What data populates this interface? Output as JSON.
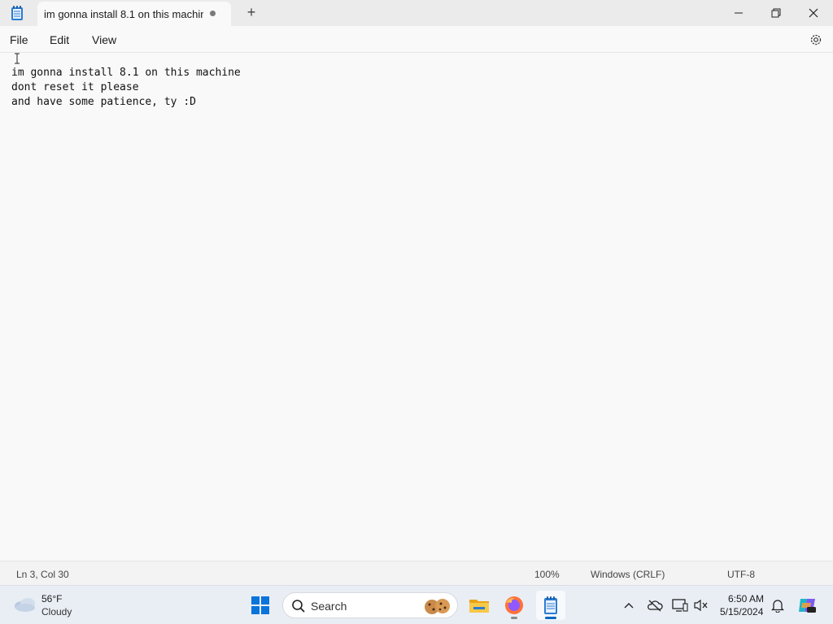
{
  "window": {
    "tab_title": "im gonna install 8.1 on this machin",
    "new_tab_symbol": "+",
    "unsaved_indicator": "modified-dot"
  },
  "menu": {
    "file": "File",
    "edit": "Edit",
    "view": "View"
  },
  "editor": {
    "text": "im gonna install 8.1 on this machine\ndont reset it please\nand have some patience, ty :D"
  },
  "statusbar": {
    "position": "Ln 3, Col 30",
    "zoom": "100%",
    "line_endings": "Windows (CRLF)",
    "encoding": "UTF-8"
  },
  "taskbar": {
    "weather_temp": "56°F",
    "weather_condition": "Cloudy",
    "search_label": "Search",
    "clock_time": "6:50 AM",
    "clock_date": "5/15/2024",
    "pinned": [
      "start-icon",
      "file-explorer-icon",
      "firefox-icon",
      "notepad-icon"
    ],
    "tray": [
      "chevron-up-icon",
      "onedrive-offline-icon",
      "display-icon",
      "sound-muted-icon",
      "bell-icon",
      "copilot-icon"
    ]
  },
  "colors": {
    "accent": "#0067c0",
    "editor_bg": "#f9f9f9",
    "taskbar_bg": "#e9eef5"
  }
}
